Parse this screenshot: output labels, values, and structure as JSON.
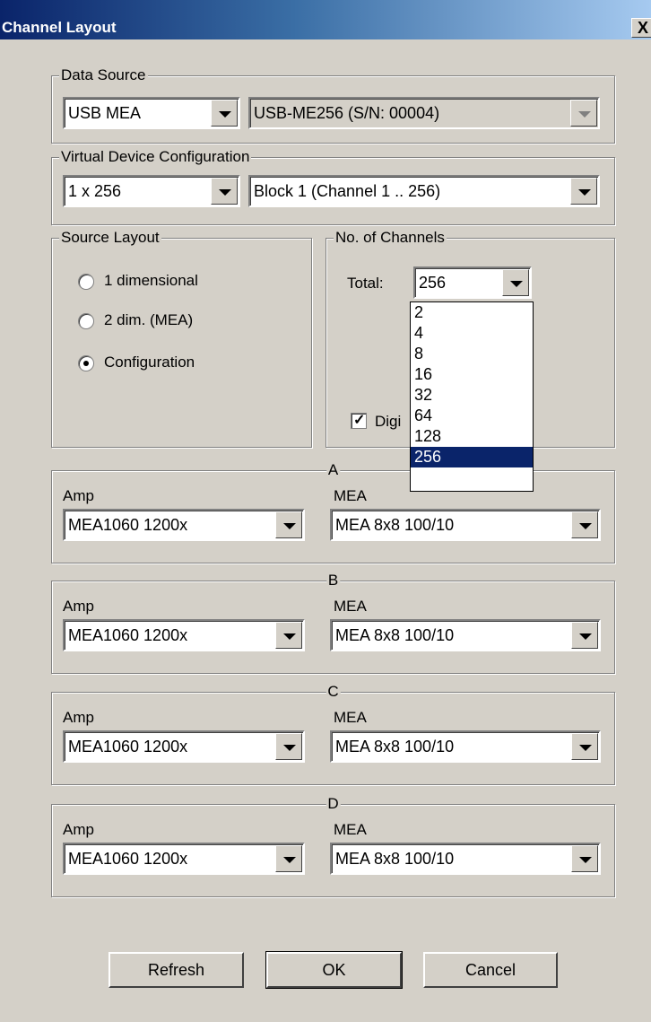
{
  "window": {
    "title": "Channel Layout",
    "close_glyph": "X"
  },
  "data_source": {
    "legend": "Data Source",
    "source_value": "USB MEA",
    "device_value": "USB-ME256  (S/N: 00004)"
  },
  "virtual_device": {
    "legend": "Virtual Device Configuration",
    "config_value": "1 x 256",
    "block_value": "Block 1 (Channel 1 .. 256)"
  },
  "source_layout": {
    "legend": "Source Layout",
    "options": [
      {
        "label": "1 dimensional",
        "selected": false
      },
      {
        "label": "2 dim. (MEA)",
        "selected": false
      },
      {
        "label": "Configuration",
        "selected": true
      }
    ]
  },
  "channels": {
    "legend": "No. of Channels",
    "total_label": "Total:",
    "total_value": "256",
    "digital_label": "Digi",
    "digital_checked": true,
    "dropdown_options": [
      "2",
      "4",
      "8",
      "16",
      "32",
      "64",
      "128",
      "256"
    ],
    "selected_option": "256"
  },
  "amp_groups": [
    {
      "legend": "A",
      "amp_label": "Amp",
      "amp_value": "MEA1060 1200x",
      "mea_label": "MEA",
      "mea_value": "MEA 8x8 100/10"
    },
    {
      "legend": "B",
      "amp_label": "Amp",
      "amp_value": "MEA1060 1200x",
      "mea_label": "MEA",
      "mea_value": "MEA 8x8 100/10"
    },
    {
      "legend": "C",
      "amp_label": "Amp",
      "amp_value": "MEA1060 1200x",
      "mea_label": "MEA",
      "mea_value": "MEA 8x8 100/10"
    },
    {
      "legend": "D",
      "amp_label": "Amp",
      "amp_value": "MEA1060 1200x",
      "mea_label": "MEA",
      "mea_value": "MEA 8x8 100/10"
    }
  ],
  "buttons": {
    "refresh": "Refresh",
    "ok": "OK",
    "cancel": "Cancel"
  },
  "colors": {
    "window_bg": "#d4d0c8",
    "title_bar_start": "#0a246a",
    "title_bar_end": "#a6caf0",
    "selection": "#0a246a"
  }
}
